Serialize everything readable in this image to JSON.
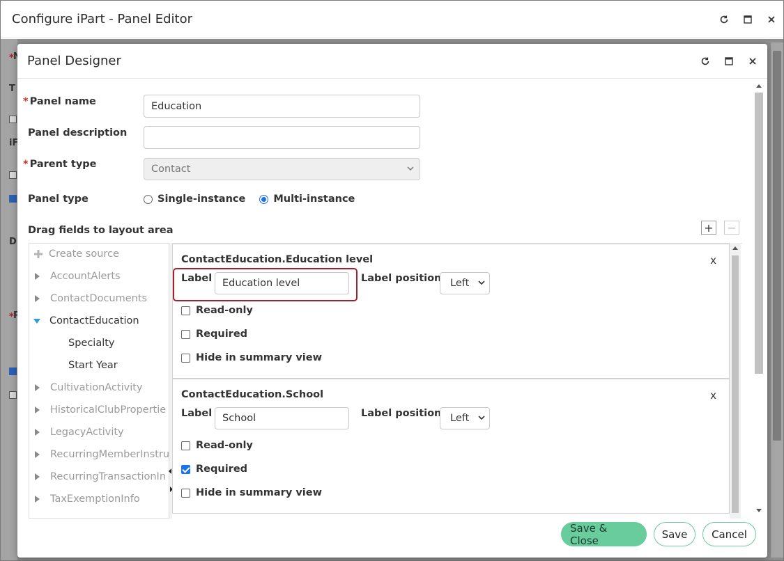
{
  "outer_window": {
    "title": "Configure iPart - Panel Editor"
  },
  "dialog": {
    "title": "Panel Designer",
    "fields": {
      "panel_name_label": "Panel name",
      "panel_name_value": "Education",
      "panel_description_label": "Panel description",
      "panel_description_value": "",
      "parent_type_label": "Parent type",
      "parent_type_value": "Contact",
      "panel_type_label": "Panel type",
      "panel_type_options": [
        "Single-instance",
        "Multi-instance"
      ],
      "panel_type_selected": "Multi-instance"
    },
    "drag_label": "Drag fields to layout area",
    "tree": {
      "create_source": "Create source",
      "items": [
        {
          "label": "AccountAlerts",
          "expanded": false
        },
        {
          "label": "ContactDocuments",
          "expanded": false
        },
        {
          "label": "ContactEducation",
          "expanded": true,
          "children": [
            "Specialty",
            "Start Year"
          ]
        },
        {
          "label": "CultivationActivity",
          "expanded": false
        },
        {
          "label": "HistoricalClubPropertie",
          "expanded": false
        },
        {
          "label": "LegacyActivity",
          "expanded": false
        },
        {
          "label": "RecurringMemberInstru",
          "expanded": false
        },
        {
          "label": "RecurringTransactionIn",
          "expanded": false
        },
        {
          "label": "TaxExemptionInfo",
          "expanded": false
        }
      ]
    },
    "layout_fields": [
      {
        "title": "ContactEducation.Education level",
        "label_caption": "Label",
        "label_value": "Education level",
        "label_position_caption": "Label position",
        "label_position_value": "Left",
        "options": [
          {
            "label": "Read-only",
            "checked": false
          },
          {
            "label": "Required",
            "checked": false
          },
          {
            "label": "Hide in summary view",
            "checked": false
          }
        ]
      },
      {
        "title": "ContactEducation.School",
        "label_caption": "Label",
        "label_value": "School",
        "label_position_caption": "Label position",
        "label_position_value": "Left",
        "options": [
          {
            "label": "Read-only",
            "checked": false
          },
          {
            "label": "Required",
            "checked": true
          },
          {
            "label": "Hide in summary view",
            "checked": false
          }
        ]
      }
    ],
    "close_glyph": "x",
    "add_glyph": "+",
    "remove_glyph": "−",
    "footer": {
      "save_close": "Save & Close",
      "save": "Save",
      "cancel": "Cancel"
    }
  },
  "background_marks": {
    "required_star": "*",
    "letters": [
      "N",
      "T",
      "iF",
      "D",
      "P"
    ]
  },
  "colors": {
    "primary_button": "#68cc9d",
    "highlight_border": "#a3202e",
    "required_star": "#c0392b",
    "accent_blue": "#1a73e8"
  }
}
